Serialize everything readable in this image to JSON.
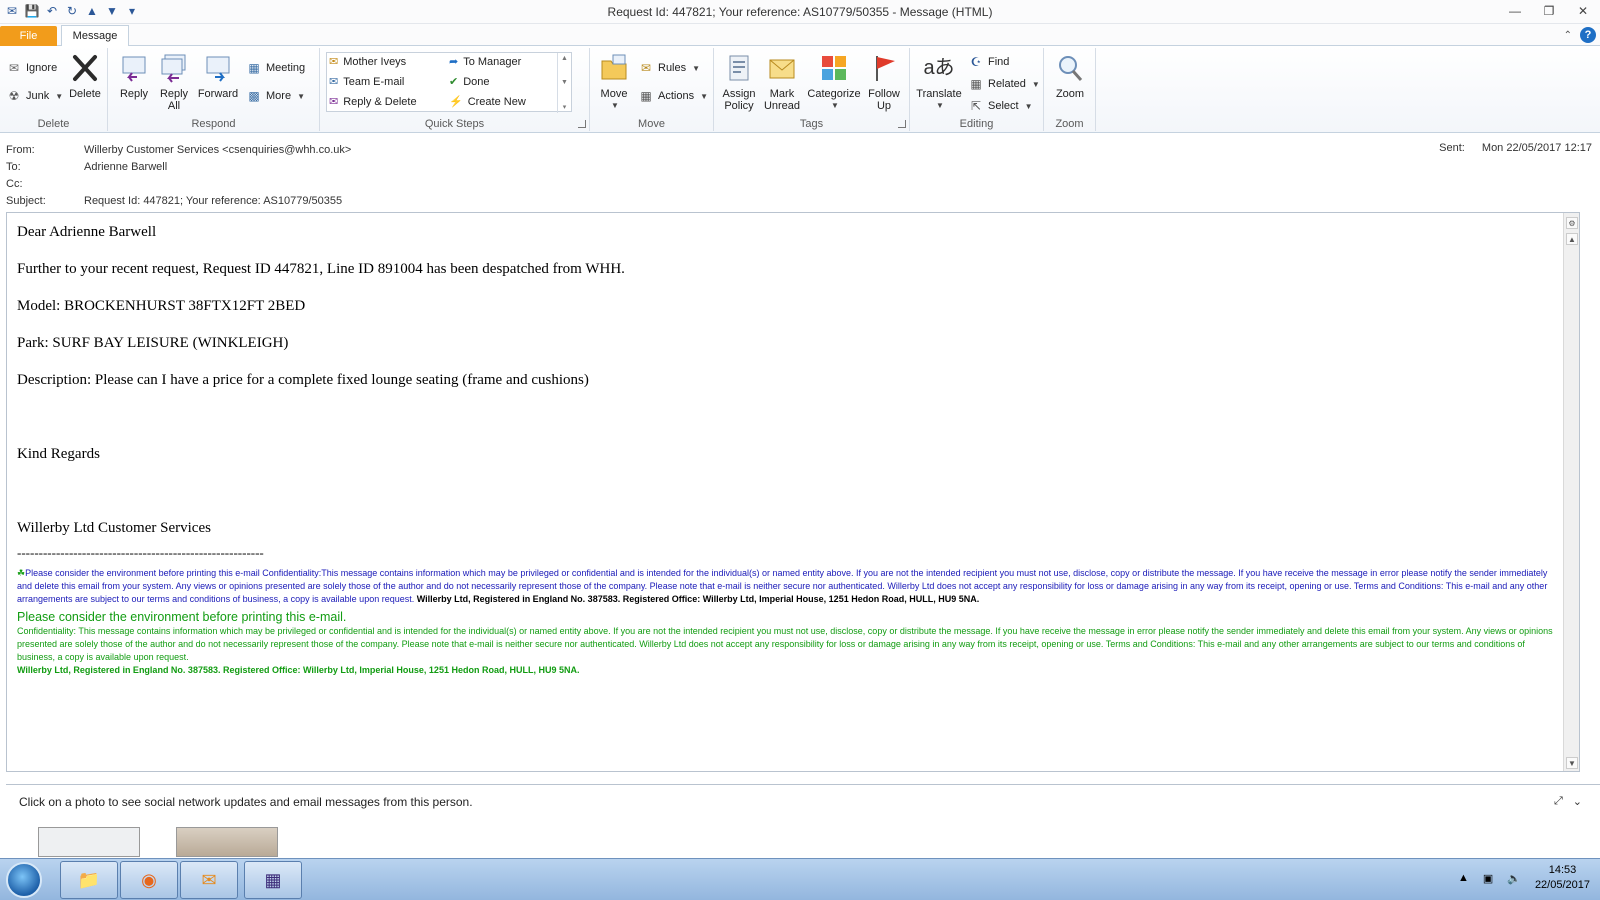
{
  "window": {
    "title": "Request Id: 447821; Your reference: AS10779/50355  -  Message (HTML)",
    "controls": [
      "—",
      "❐",
      "✕"
    ]
  },
  "qat": [
    "✉",
    "💾",
    "↶",
    "↻",
    "▲",
    "▼",
    "▾"
  ],
  "tabs": {
    "file": "File",
    "message": "Message"
  },
  "ribbon": {
    "delete": {
      "ignore": "Ignore",
      "junk": "Junk",
      "delete": "Delete",
      "label": "Delete"
    },
    "respond": {
      "reply": "Reply",
      "reply_all": [
        "Reply",
        "All"
      ],
      "forward": "Forward",
      "meeting": "Meeting",
      "more": "More",
      "label": "Respond"
    },
    "quick_steps": {
      "items": [
        "Mother Iveys",
        "To Manager",
        "Team E-mail",
        "Done",
        "Reply & Delete",
        "Create New"
      ],
      "label": "Quick Steps"
    },
    "move": {
      "move": "Move",
      "rules": "Rules",
      "actions": "Actions",
      "label": "Move"
    },
    "tags": {
      "assign_policy": [
        "Assign",
        "Policy"
      ],
      "mark_unread": [
        "Mark",
        "Unread"
      ],
      "categorize": "Categorize",
      "follow_up": [
        "Follow",
        "Up"
      ],
      "label": "Tags"
    },
    "editing": {
      "translate": "Translate",
      "find": "Find",
      "related": "Related",
      "select": "Select",
      "label": "Editing"
    },
    "zoom": {
      "zoom": "Zoom",
      "label": "Zoom"
    }
  },
  "header": {
    "from_label": "From:",
    "from": "Willerby Customer Services <csenquiries@whh.co.uk>",
    "to_label": "To:",
    "to": "Adrienne Barwell",
    "cc_label": "Cc:",
    "cc": "",
    "subject_label": "Subject:",
    "subject": "Request Id: 447821; Your reference: AS10779/50355",
    "sent_label": "Sent:",
    "sent": "Mon 22/05/2017 12:17"
  },
  "body": {
    "greeting": "Dear Adrienne Barwell",
    "line1": "Further to your recent request, Request ID 447821, Line ID 891004 has been despatched from WHH.",
    "model": "Model: BROCKENHURST 38FTX12FT 2BED",
    "park": "Park: SURF BAY LEISURE (WINKLEIGH)",
    "description": "Description: Please can I have a price for a complete fixed lounge seating (frame and cushions)",
    "regards": "Kind Regards",
    "signature": "Willerby Ltd Customer Services",
    "dashes": "---------------------------------------------------------",
    "disclaimer_blue": "Please consider the environment before printing this e-mail Confidentiality:This message contains information which may be privileged or confidential and is intended for the individual(s) or named entity above. If you are not the intended recipient you must not use, disclose, copy or distribute the message. If you have receive the message in error please notify the sender immediately and delete this email from your system. Any views or opinions presented are solely those of the author and do not necessarily represent those of the company. Please note that e-mail is neither secure nor authenticated. Willerby Ltd does not accept any responsibility for loss or damage arising in any way from its receipt, opening or use. Terms and Conditions: This e-mail and any other arrangements are subject to our terms and conditions of business, a copy is available upon request.",
    "disclaimer_blue_bold": "Willerby Ltd, Registered in England No. 387583. Registered Office: Willerby Ltd, Imperial House, 1251 Hedon Road, HULL, HU9 5NA.",
    "green_heading": "Please consider the environment before printing this e-mail.",
    "disclaimer_green": "Confidentiality: This message contains information which may be privileged or confidential and is intended for the individual(s) or named entity above. If you are not the intended recipient you must not use, disclose, copy or distribute the message. If you have receive the message in error please notify the sender immediately and delete this email from your system. Any views or opinions presented are solely those of the author and do not necessarily represent those of the company. Please note that e-mail is neither secure nor authenticated. Willerby Ltd does not accept any responsibility for loss or damage arising in any way from its receipt, opening or use. Terms and Conditions: This e-mail and any other arrangements are subject to our terms and conditions of business, a copy is available upon request.",
    "disclaimer_green_bold": "Willerby Ltd, Registered in England No. 387583. Registered Office: Willerby Ltd, Imperial House, 1251 Hedon Road, HULL, HU9 5NA."
  },
  "people_pane": {
    "hint": "Click on a photo to see social network updates and email messages from this person."
  },
  "taskbar": {
    "time": "14:53",
    "date": "22/05/2017"
  },
  "colors": {
    "file_tab": "#f29c1b",
    "disclaimer_blue": "#1a1ab8",
    "disclaimer_green": "#129c12",
    "taskbar": "#a9c6e8"
  }
}
